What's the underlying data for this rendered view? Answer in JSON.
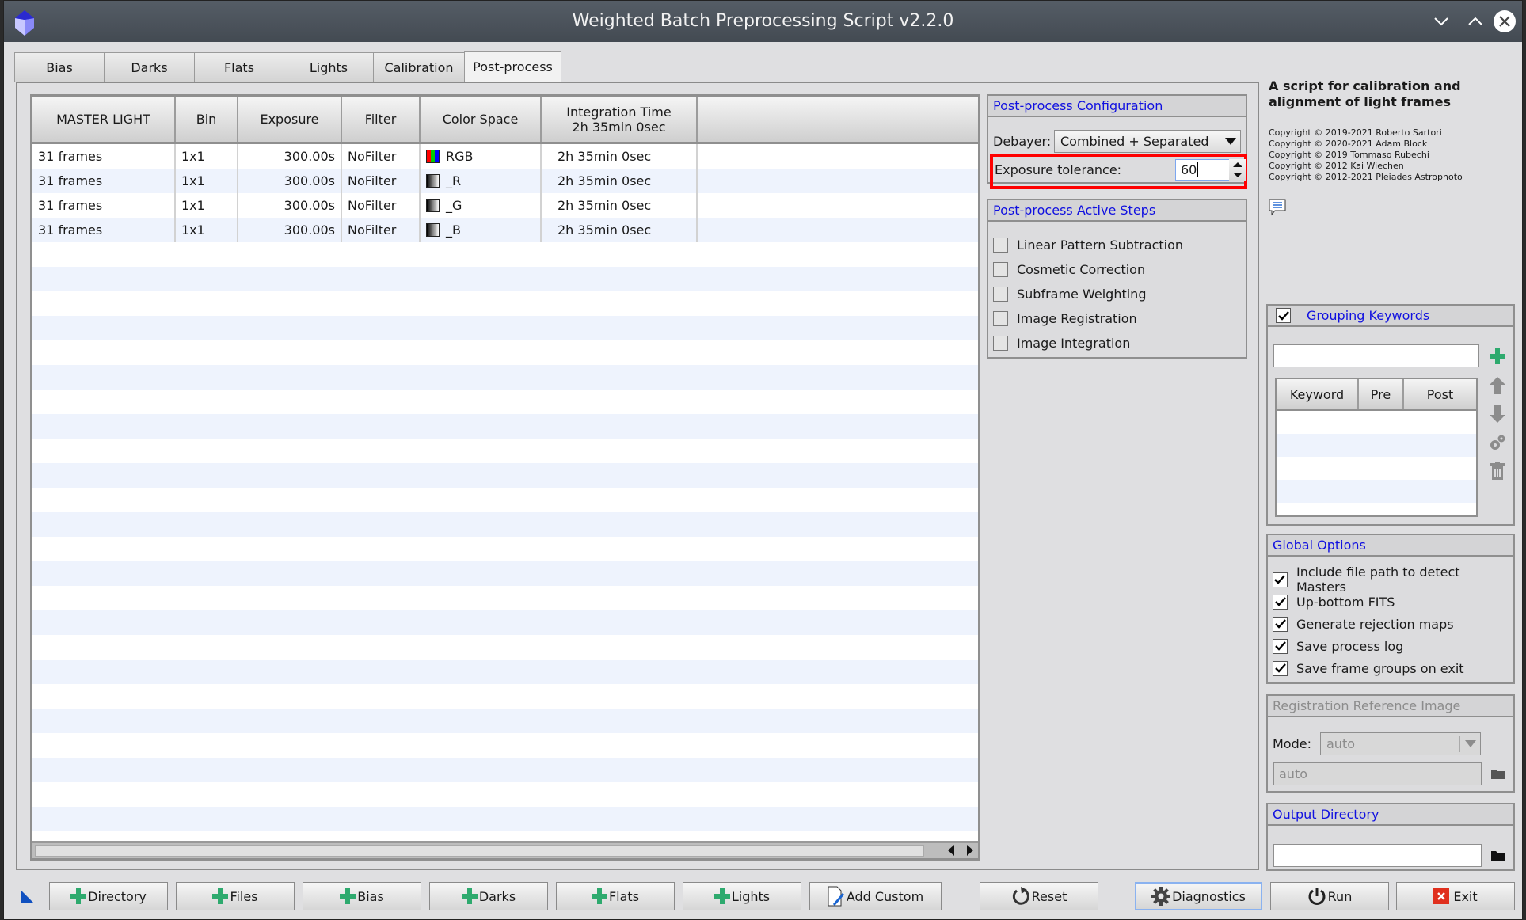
{
  "window": {
    "title": "Weighted Batch Preprocessing Script v2.2.0",
    "controls": [
      "minimize",
      "maximize",
      "close"
    ]
  },
  "tabs": [
    {
      "label": "Bias",
      "active": false
    },
    {
      "label": "Darks",
      "active": false
    },
    {
      "label": "Flats",
      "active": false
    },
    {
      "label": "Lights",
      "active": false
    },
    {
      "label": "Calibration",
      "active": false
    },
    {
      "label": "Post-process",
      "active": true
    }
  ],
  "table": {
    "columns": [
      "MASTER LIGHT",
      "Bin",
      "Exposure",
      "Filter",
      "Color Space",
      "Integration Time"
    ],
    "integration_total": "2h 35min  0sec",
    "rows": [
      {
        "frames": "31 frames",
        "bin": "1x1",
        "exposure": "300.00s",
        "filter": "NoFilter",
        "color_space": "RGB",
        "color_icon": "rgb-icon",
        "integration": "2h 35min  0sec"
      },
      {
        "frames": "31 frames",
        "bin": "1x1",
        "exposure": "300.00s",
        "filter": "NoFilter",
        "color_space": "_R",
        "color_icon": "grayscale-icon",
        "integration": "2h 35min  0sec"
      },
      {
        "frames": "31 frames",
        "bin": "1x1",
        "exposure": "300.00s",
        "filter": "NoFilter",
        "color_space": "_G",
        "color_icon": "grayscale-icon",
        "integration": "2h 35min  0sec"
      },
      {
        "frames": "31 frames",
        "bin": "1x1",
        "exposure": "300.00s",
        "filter": "NoFilter",
        "color_space": "_B",
        "color_icon": "grayscale-icon",
        "integration": "2h 35min  0sec"
      }
    ]
  },
  "config": {
    "title": "Post-process  Configuration",
    "debayer_label": "Debayer:",
    "debayer_value": "Combined + Separated",
    "exposure_tolerance_label": "Exposure tolerance:",
    "exposure_tolerance_value": "60"
  },
  "steps": {
    "title": "Post-process  Active  Steps",
    "items": [
      {
        "label": "Linear Pattern Subtraction",
        "checked": false
      },
      {
        "label": "Cosmetic Correction",
        "checked": false
      },
      {
        "label": "Subframe Weighting",
        "checked": false
      },
      {
        "label": "Image Registration",
        "checked": false
      },
      {
        "label": "Image Integration",
        "checked": false
      }
    ]
  },
  "about": {
    "title": "A script for calibration and alignment of light frames",
    "copyrights": [
      "Copyright © 2019-2021 Roberto Sartori",
      "Copyright © 2020-2021 Adam Block",
      "Copyright © 2019 Tommaso Rubechi",
      "Copyright © 2012 Kai Wiechen",
      "Copyright © 2012-2021 Pleiades Astrophoto"
    ]
  },
  "grouping": {
    "title": "Grouping Keywords",
    "enabled": true,
    "input_value": "",
    "columns": [
      "Keyword",
      "Pre",
      "Post"
    ]
  },
  "global_options": {
    "title": "Global Options",
    "items": [
      {
        "label": "Include file path to detect Masters",
        "checked": true
      },
      {
        "label": "Up-bottom FITS",
        "checked": true
      },
      {
        "label": "Generate rejection maps",
        "checked": true
      },
      {
        "label": "Save process log",
        "checked": true
      },
      {
        "label": "Save frame groups on exit",
        "checked": true
      }
    ]
  },
  "registration": {
    "title": "Registration Reference Image",
    "mode_label": "Mode:",
    "mode_value": "auto",
    "path_value": "auto"
  },
  "output": {
    "title": "Output Directory",
    "path_value": ""
  },
  "buttons": {
    "directory": "Directory",
    "files": "Files",
    "bias": "Bias",
    "darks": "Darks",
    "flats": "Flats",
    "lights": "Lights",
    "add_custom": "Add Custom",
    "reset": "Reset",
    "diagnostics": "Diagnostics",
    "run": "Run",
    "exit": "Exit"
  },
  "colors": {
    "accent_blue": "#1010e0",
    "add_green": "#2eaa6e",
    "exit_red": "#e0301e",
    "highlight_red": "#ff0000"
  }
}
